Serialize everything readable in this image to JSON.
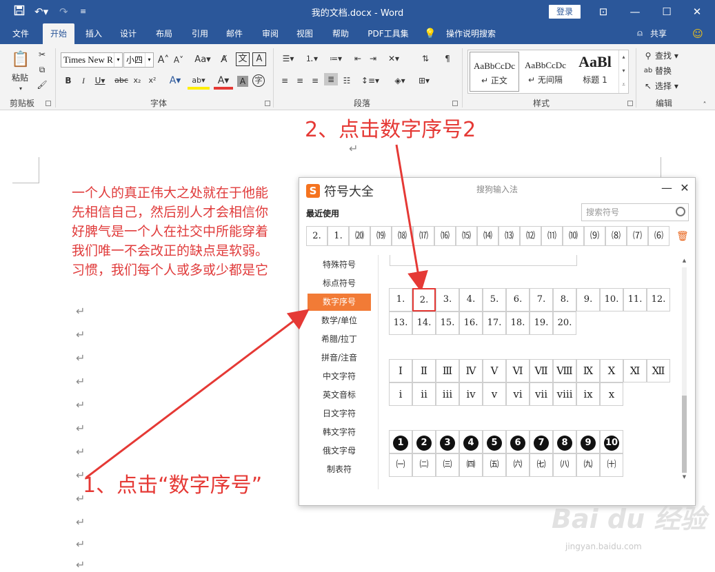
{
  "titlebar": {
    "title": "我的文档.docx  -  Word",
    "login": "登录",
    "save_icon": "save-icon",
    "undo_icon": "undo-icon",
    "redo_icon": "redo-icon"
  },
  "tabs": [
    "文件",
    "开始",
    "插入",
    "设计",
    "布局",
    "引用",
    "邮件",
    "审阅",
    "视图",
    "帮助",
    "PDF工具集",
    "操作说明搜索"
  ],
  "share": "共享",
  "ribbon": {
    "clipboard": {
      "paste": "粘贴",
      "label": "剪贴板"
    },
    "font": {
      "name": "Times New R",
      "size": "小四",
      "label": "字体"
    },
    "paragraph": {
      "label": "段落"
    },
    "styles": {
      "label": "样式",
      "items": [
        {
          "sample": "AaBbCcDc",
          "name": "正文"
        },
        {
          "sample": "AaBbCcDc",
          "name": "无间隔"
        },
        {
          "sample": "AaBl",
          "name": "标题 1"
        }
      ]
    },
    "editing": {
      "find": "查找",
      "replace": "替换",
      "select": "选择",
      "label": "编辑"
    }
  },
  "document": {
    "lines": [
      "一个人的真正伟大之处就在于他能",
      "先相信自己，然后别人才会相信你",
      "好脾气是一个人在社交中所能穿着",
      "我们唯一不会改正的缺点是软弱。",
      "习惯，我们每个人或多或少都是它"
    ]
  },
  "annotations": {
    "step1": "1、点击“数字序号”",
    "step2": "2、点击数字序号2"
  },
  "dialog": {
    "title": "符号大全",
    "subtitle": "搜狗输入法",
    "recent_label": "最近使用",
    "search_placeholder": "搜索符号",
    "recent": [
      "2.",
      "1.",
      "⒇",
      "⒆",
      "⒅",
      "⒄",
      "⒃",
      "⒂",
      "⒁",
      "⒀",
      "⑿",
      "⑾",
      "⑽",
      "⑼",
      "⑻",
      "⑺",
      "⑹"
    ],
    "categories": [
      "特殊符号",
      "标点符号",
      "数字序号",
      "数学/单位",
      "希腊/拉丁",
      "拼音/注音",
      "中文字符",
      "英文音标",
      "日文字符",
      "韩文字符",
      "俄文字母",
      "制表符"
    ],
    "active_category": "数字序号",
    "period_numbers": [
      "1.",
      "2.",
      "3.",
      "4.",
      "5.",
      "6.",
      "7.",
      "8.",
      "9.",
      "10.",
      "11.",
      "12.",
      "13.",
      "14.",
      "15.",
      "16.",
      "17.",
      "18.",
      "19.",
      "20."
    ],
    "roman_upper": [
      "Ⅰ",
      "Ⅱ",
      "Ⅲ",
      "Ⅳ",
      "Ⅴ",
      "Ⅵ",
      "Ⅶ",
      "Ⅷ",
      "Ⅸ",
      "Ⅹ",
      "Ⅺ",
      "Ⅻ"
    ],
    "roman_lower": [
      "ⅰ",
      "ⅱ",
      "ⅲ",
      "ⅳ",
      "ⅴ",
      "ⅵ",
      "ⅶ",
      "ⅷ",
      "ⅸ",
      "ⅹ"
    ],
    "circled": [
      "1",
      "2",
      "3",
      "4",
      "5",
      "6",
      "7",
      "8",
      "9",
      "10"
    ],
    "paren_cn": [
      "㈠",
      "㈡",
      "㈢",
      "㈣",
      "㈤",
      "㈥",
      "㈦",
      "㈧",
      "㈨",
      "㈩"
    ],
    "highlighted": "2."
  },
  "watermark": "Bai du 经验",
  "watermark_url": "jingyan.baidu.com"
}
